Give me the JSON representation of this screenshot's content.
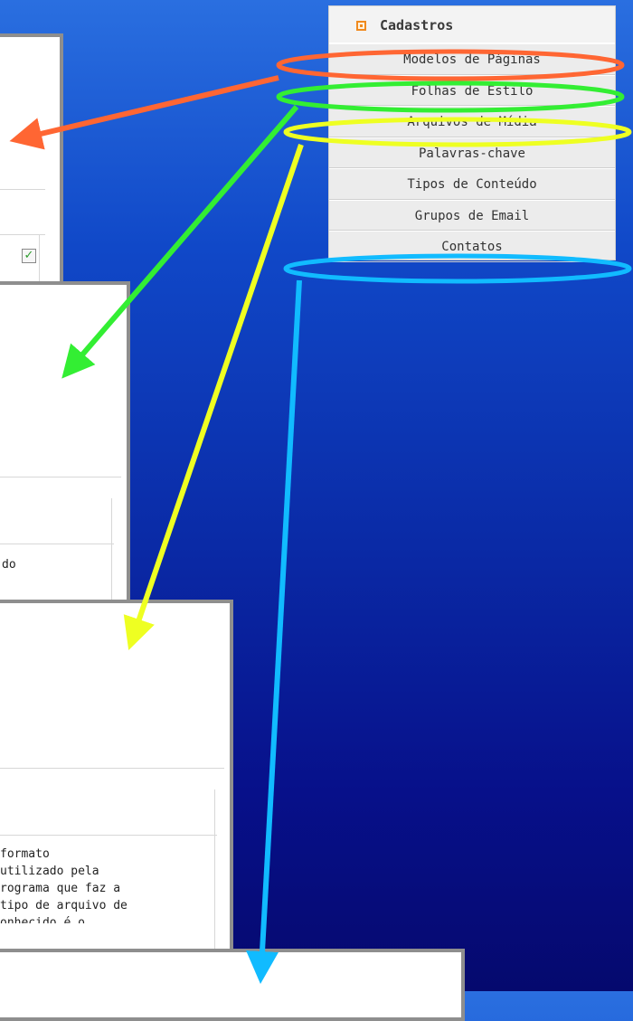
{
  "menu": {
    "title": "Cadastros",
    "icon": "orange-square-icon",
    "items": [
      {
        "label": "Modelos de Páginas",
        "highlight": "#ff6633"
      },
      {
        "label": "Folhas de Estilo",
        "highlight": "#33ee33"
      },
      {
        "label": "Arquivos de Mídia",
        "highlight": "#eeff22"
      },
      {
        "label": "Palavras-chave",
        "highlight": null
      },
      {
        "label": "Tipos de Conteúdo",
        "highlight": null
      },
      {
        "label": "Grupos de Email",
        "highlight": null
      },
      {
        "label": "Contatos",
        "highlight": "#11bbff"
      }
    ]
  },
  "panels": {
    "stylesheets": {
      "cell_text": "do"
    },
    "media": {
      "description_lines": [
        "formato",
        "utilizado pela",
        "rograma que faz a",
        "tipo de arquivo de",
        "onhecido é o"
      ]
    }
  },
  "colors": {
    "background_top": "#2a6fe0",
    "background_bottom": "#05096e",
    "arrow_orange": "#ff6633",
    "arrow_green": "#33ee33",
    "arrow_yellow": "#eeff22",
    "arrow_blue": "#11bbff"
  }
}
